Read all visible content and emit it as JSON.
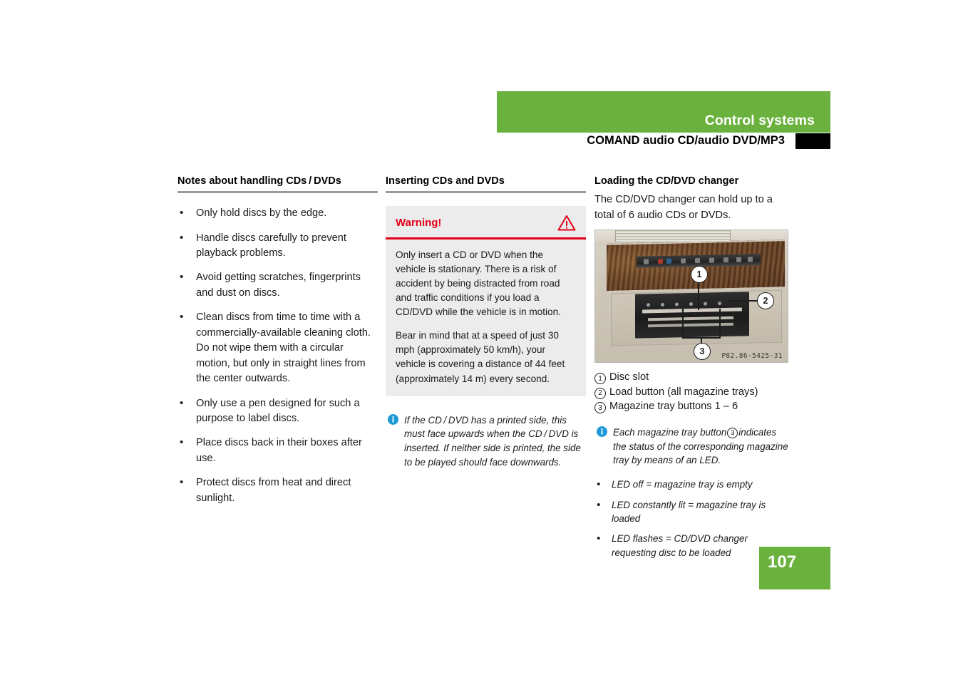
{
  "header": {
    "chapter_title": "Control systems",
    "section_title": "COMAND audio CD/audio DVD/MP3",
    "green": "#6ab23d",
    "tab_color": "#000000"
  },
  "columns": {
    "left": {
      "heading": "Notes about handling CDs / DVDs",
      "bullets": [
        "Only hold discs by the edge.",
        "Handle discs carefully to prevent playback problems.",
        "Avoid getting scratches, fingerprints and dust on discs.",
        "Clean discs from time to time with a commercially-available cleaning cloth. Do not wipe them with a circular motion, but only in straight lines from the center outwards.",
        "Only use a pen designed for such a purpose to label discs.",
        "Place discs back in their boxes after use.",
        "Protect discs from heat and direct sunlight."
      ]
    },
    "middle": {
      "heading": "Inserting CDs and DVDs",
      "warning": {
        "title": "Warning!",
        "icon": "warning-triangle-icon",
        "accent": "#e2001a",
        "background": "#ececec",
        "paragraphs": [
          "Only insert a CD or DVD when the vehicle is stationary. There is a risk of accident by being distracted from road and traffic conditions if you load a CD/DVD while the vehicle is in motion.",
          "Bear in mind that at a speed of just 30 mph (approximately 50 km/h), your vehicle is covering a distance of 44 feet (approximately 14 m) every second."
        ]
      },
      "note": {
        "icon": "info-icon",
        "text": "If the CD / DVD has a printed side, this must face upwards when the CD / DVD is inserted. If neither side is printed, the side to be played should face downwards."
      }
    },
    "right": {
      "heading": "Loading the CD/DVD changer",
      "intro": "The CD/DVD changer can hold up to a total of 6 audio CDs or DVDs.",
      "figure": {
        "name": "cd-dvd-changer-photo",
        "code": "P82.86-5425-31",
        "callouts": [
          "1",
          "2",
          "3"
        ]
      },
      "legend": [
        {
          "num": "1",
          "label": "Disc slot"
        },
        {
          "num": "2",
          "label": "Load button (all magazine trays)"
        },
        {
          "num": "3",
          "label": "Magazine tray buttons 1 – 6"
        }
      ],
      "note": {
        "icon": "info-icon",
        "text_before": "Each magazine tray button",
        "text_num": "3",
        "text_after": "indicates the status of the corresponding magazine tray by means of an LED."
      },
      "led_bullets": [
        "LED off = magazine tray is empty",
        "LED constantly lit = magazine tray is loaded",
        "LED flashes = CD/DVD changer requesting disc to be loaded"
      ]
    }
  },
  "footer": {
    "page_number": "107",
    "page_box_color": "#6ab23d"
  }
}
